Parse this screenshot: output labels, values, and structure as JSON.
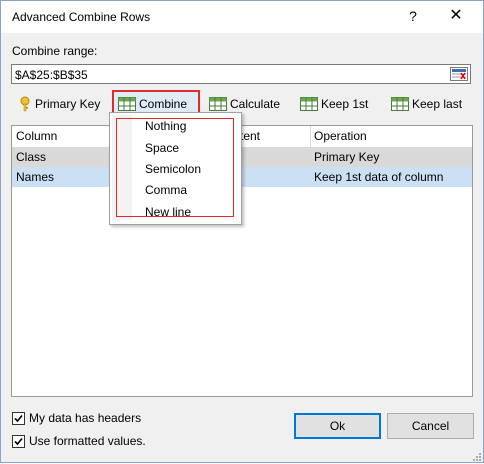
{
  "window": {
    "title": "Advanced Combine Rows",
    "help_label": "?",
    "close_label": "✕"
  },
  "range": {
    "label": "Combine range:",
    "value": "$A$25:$B$35"
  },
  "toolbar": {
    "primary_key": "Primary Key",
    "combine": "Combine",
    "calculate": "Calculate",
    "keep_first": "Keep 1st",
    "keep_last": "Keep last"
  },
  "grid": {
    "headers": [
      "Column",
      "Content",
      "Operation"
    ],
    "rows": [
      {
        "column": "Class",
        "operation": "Primary Key"
      },
      {
        "column": "Names",
        "operation": "Keep 1st data of column"
      }
    ],
    "visible_header_fragment": "tent"
  },
  "combine_menu": {
    "items": [
      "Nothing",
      "Space",
      "Semicolon",
      "Comma",
      "New line"
    ]
  },
  "options": {
    "headers_checkbox": {
      "label": "My data has headers",
      "checked": true
    },
    "formatted_checkbox": {
      "label": "Use formatted values.",
      "checked": true
    }
  },
  "buttons": {
    "ok": "Ok",
    "cancel": "Cancel"
  },
  "colors": {
    "highlight_red": "#e02b2b",
    "selected_row": "#cce0f5",
    "primary_row": "#d9d9d9"
  }
}
